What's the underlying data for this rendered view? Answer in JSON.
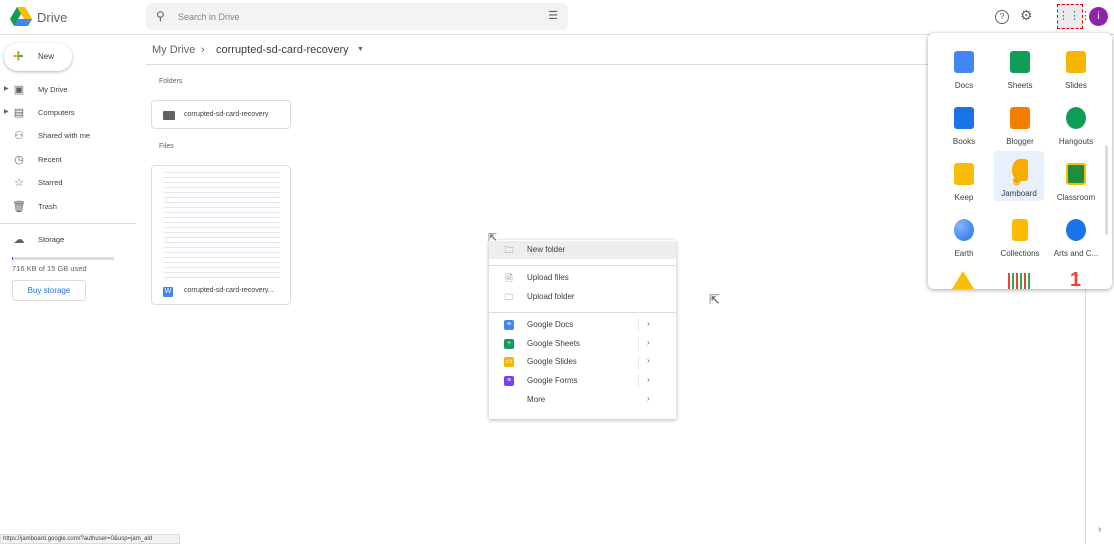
{
  "header": {
    "brand": "Drive",
    "search_placeholder": "Search in Drive",
    "help_icon": "help-icon",
    "settings_icon": "gear-icon",
    "apps_icon": "apps-grid-icon",
    "avatar_initial": "i"
  },
  "sidebar": {
    "new_label": "New",
    "items": [
      {
        "label": "My Drive"
      },
      {
        "label": "Computers"
      },
      {
        "label": "Shared with me"
      },
      {
        "label": "Recent"
      },
      {
        "label": "Starred"
      },
      {
        "label": "Trash"
      }
    ],
    "storage_label": "Storage",
    "storage_used": "716 KB of 15 GB used",
    "storage_fraction": 4.66e-05,
    "buy_storage": "Buy storage"
  },
  "breadcrumb": {
    "root": "My Drive",
    "current": "corrupted-sd-card-recovery"
  },
  "main": {
    "folders_heading": "Folders",
    "folder_name": "corrupted-sd-card-recovery",
    "files_heading": "Files",
    "file_name": "corrupted-sd-card-recovery...",
    "file_type_badge": "W"
  },
  "context_menu": {
    "items": [
      {
        "label": "New folder"
      },
      {
        "label": "Upload files"
      },
      {
        "label": "Upload folder"
      },
      {
        "label": "Google Docs"
      },
      {
        "label": "Google Sheets"
      },
      {
        "label": "Google Slides"
      },
      {
        "label": "Google Forms"
      },
      {
        "label": "More"
      }
    ]
  },
  "apps_menu": {
    "apps": [
      {
        "label": "Docs",
        "color": "#4285f4"
      },
      {
        "label": "Sheets",
        "color": "#0f9d58"
      },
      {
        "label": "Slides",
        "color": "#f4b400"
      },
      {
        "label": "Books",
        "color": "#1a73e8"
      },
      {
        "label": "Blogger",
        "color": "#f57d00"
      },
      {
        "label": "Hangouts",
        "color": "#0f9d58"
      },
      {
        "label": "Keep",
        "color": "#fbbc04"
      },
      {
        "label": "Jamboard",
        "color": "#f9ab00"
      },
      {
        "label": "Classroom",
        "color": "#1e8e3e"
      },
      {
        "label": "Earth",
        "color": "#4285f4"
      },
      {
        "label": "Collections",
        "color": "#fbbc04"
      },
      {
        "label": "Arts and C..."
      }
    ]
  },
  "status_url": "https://jamboard.google.com/?authuser=0&usp=jam_ald"
}
